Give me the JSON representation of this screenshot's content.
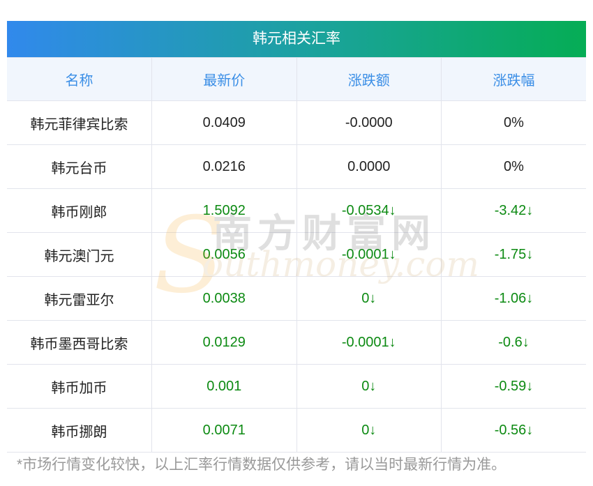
{
  "title": "韩元相关汇率",
  "columns": [
    "名称",
    "最新价",
    "涨跌额",
    "涨跌幅"
  ],
  "rows": [
    {
      "name": "韩元菲律宾比索",
      "price": "0.0409",
      "change": "-0.0000",
      "pct": "0%",
      "down": false
    },
    {
      "name": "韩元台币",
      "price": "0.0216",
      "change": "0.0000",
      "pct": "0%",
      "down": false
    },
    {
      "name": "韩币刚郎",
      "price": "1.5092",
      "change": "-0.0534↓",
      "pct": "-3.42↓",
      "down": true
    },
    {
      "name": "韩元澳门元",
      "price": "0.0056",
      "change": "-0.0001↓",
      "pct": "-1.75↓",
      "down": true
    },
    {
      "name": "韩元雷亚尔",
      "price": "0.0038",
      "change": "0↓",
      "pct": "-1.06↓",
      "down": true
    },
    {
      "name": "韩币墨西哥比索",
      "price": "0.0129",
      "change": "-0.0001↓",
      "pct": "-0.6↓",
      "down": true
    },
    {
      "name": "韩币加币",
      "price": "0.001",
      "change": "0↓",
      "pct": "-0.59↓",
      "down": true
    },
    {
      "name": "韩币挪朗",
      "price": "0.0071",
      "change": "0↓",
      "pct": "-0.56↓",
      "down": true
    }
  ],
  "note": "*市场行情变化较快，以上汇率行情数据仅供参考，请以当时最新行情为准。",
  "watermark": {
    "cn": "南方财富网",
    "en": "southmoney.com"
  },
  "colors": {
    "header": "#3a8ee6",
    "down": "#0c8a12",
    "gradient_start": "#3189ec",
    "gradient_end": "#05ad55"
  }
}
